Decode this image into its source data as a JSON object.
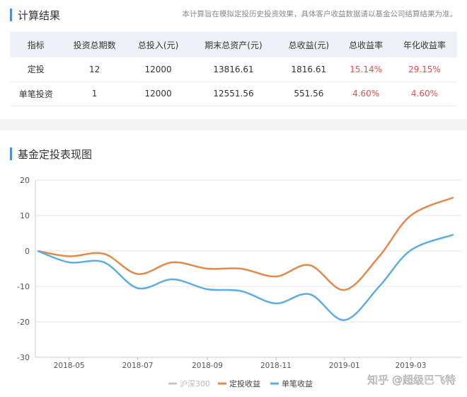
{
  "section1": {
    "title": "计算结果",
    "note": "本计算旨在模拟定投历史投资效果，具体客户收益数据请以基金公司结算结果为准。"
  },
  "table": {
    "headers": [
      "指标",
      "投资总期数",
      "总投入(元)",
      "期末总资产(元)",
      "总收益(元)",
      "总收益率",
      "年化收益率"
    ],
    "rows": [
      [
        "定投",
        "12",
        "12000",
        "13816.61",
        "1816.61",
        "15.14%",
        "29.15%"
      ],
      [
        "单笔投资",
        "1",
        "12000",
        "12551.56",
        "551.56",
        "4.60%",
        "4.60%"
      ]
    ]
  },
  "section2": {
    "title": "基金定投表现图"
  },
  "watermark": "知乎 @超级巴飞特",
  "colors": {
    "accent": "#4b8fde",
    "red": "#e0504f",
    "orange": "#e08a4e",
    "blue": "#5dade2",
    "grey": "#c8c8c8"
  },
  "chart_data": {
    "type": "line",
    "title": "",
    "xlabel": "",
    "ylabel": "",
    "ylim": [
      -30,
      20
    ],
    "yticks": [
      20,
      10,
      0,
      -10,
      -20,
      -30
    ],
    "xlim": [
      "2018-04-01",
      "2019-04-15"
    ],
    "xticks": [
      "2018-05",
      "2018-07",
      "2018-09",
      "2018-11",
      "2019-01",
      "2019-03"
    ],
    "grid": "horizontal",
    "legend_position": "bottom",
    "series": [
      {
        "name": "沪深300",
        "color": "#c8c8c8",
        "x": [],
        "y": []
      },
      {
        "name": "定投收益",
        "color": "#e08a4e",
        "x": [
          "2018-04-03",
          "2018-05-01",
          "2018-06-01",
          "2018-07-01",
          "2018-08-01",
          "2018-09-01",
          "2018-10-01",
          "2018-11-01",
          "2018-12-01",
          "2019-01-01",
          "2019-02-01",
          "2019-03-01",
          "2019-04-08"
        ],
        "y": [
          0,
          -1.5,
          -0.8,
          -6.5,
          -3.2,
          -5.0,
          -5.0,
          -7.2,
          -4.0,
          -11.0,
          -1.5,
          10.0,
          15.1
        ]
      },
      {
        "name": "单笔收益",
        "color": "#5dade2",
        "x": [
          "2018-04-03",
          "2018-05-01",
          "2018-06-01",
          "2018-07-01",
          "2018-08-01",
          "2018-09-01",
          "2018-10-01",
          "2018-11-01",
          "2018-12-01",
          "2019-01-01",
          "2019-02-01",
          "2019-03-01",
          "2019-04-08"
        ],
        "y": [
          0,
          -3.2,
          -3.2,
          -10.5,
          -8.0,
          -10.8,
          -11.3,
          -14.8,
          -12.2,
          -19.5,
          -10.0,
          0.2,
          4.6
        ]
      }
    ]
  }
}
